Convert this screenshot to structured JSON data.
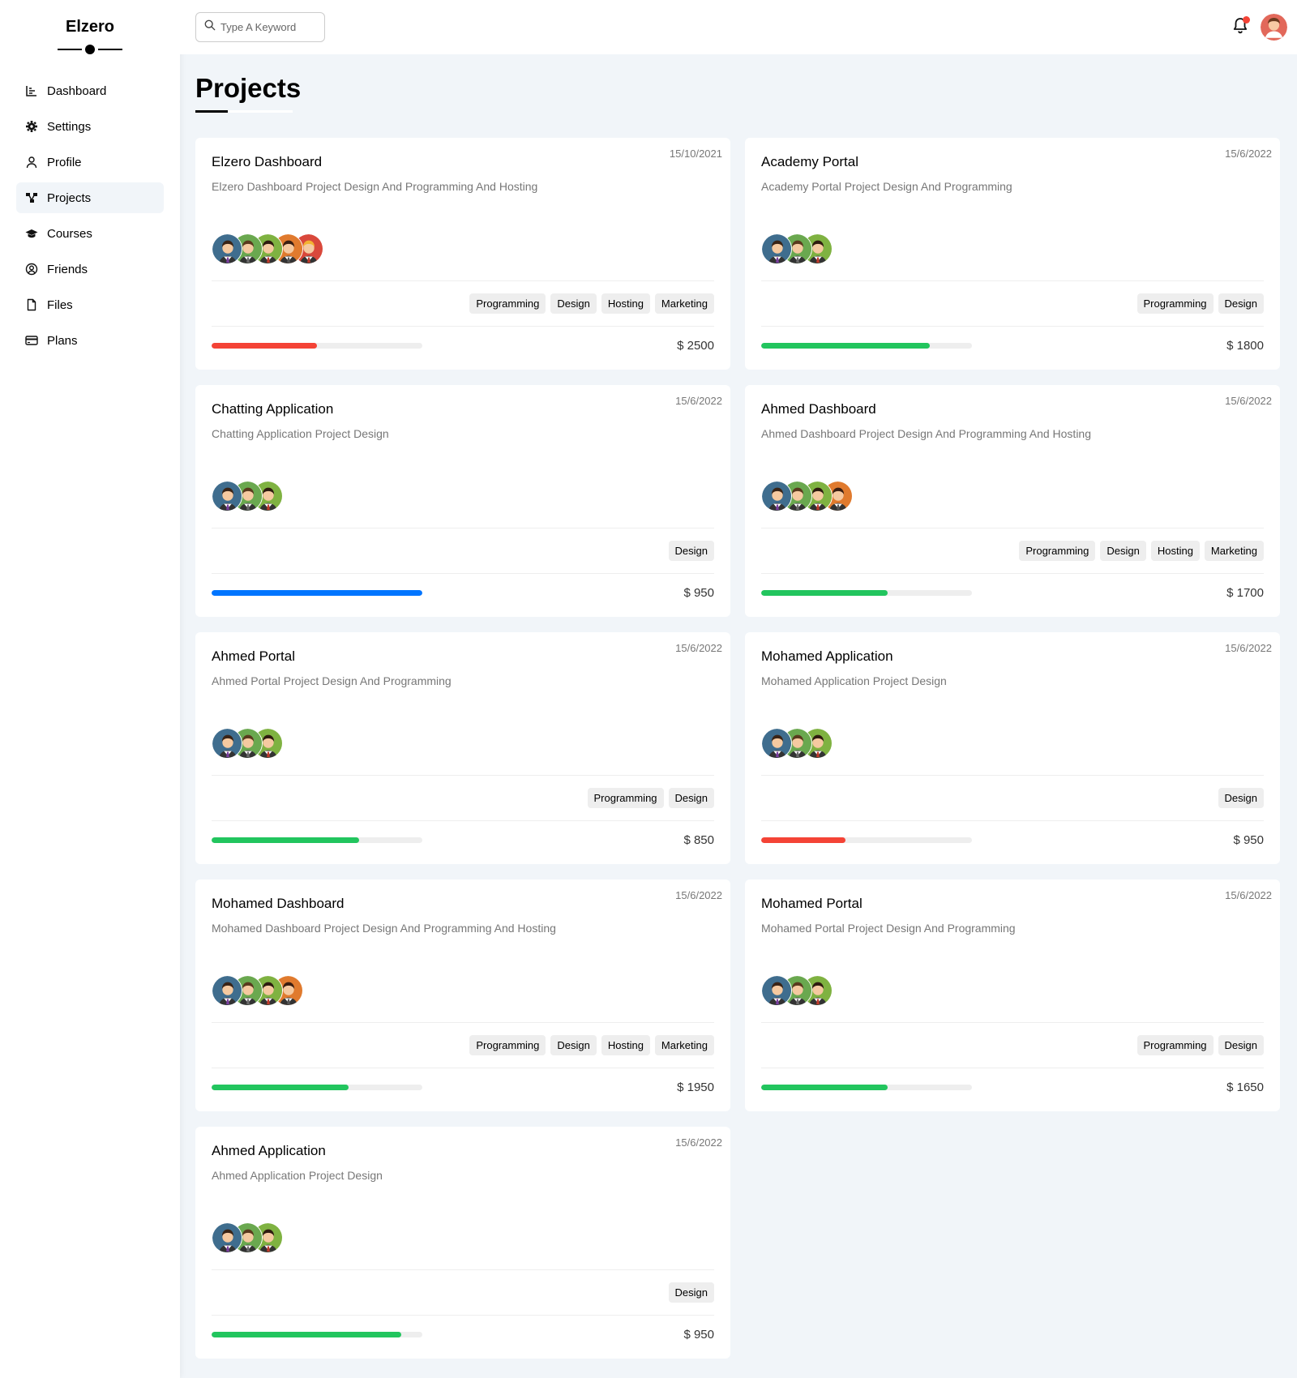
{
  "brand": "Elzero",
  "nav": [
    {
      "label": "Dashboard",
      "icon": "chart-icon"
    },
    {
      "label": "Settings",
      "icon": "gear-icon"
    },
    {
      "label": "Profile",
      "icon": "user-icon"
    },
    {
      "label": "Projects",
      "icon": "diagram-icon",
      "active": true
    },
    {
      "label": "Courses",
      "icon": "graduation-cap-icon"
    },
    {
      "label": "Friends",
      "icon": "user-circle-icon"
    },
    {
      "label": "Files",
      "icon": "file-icon"
    },
    {
      "label": "Plans",
      "icon": "credit-card-icon"
    }
  ],
  "search": {
    "placeholder": "Type A Keyword"
  },
  "page_title": "Projects",
  "colors": {
    "red": "#f44336",
    "green": "#22c55e",
    "blue": "#0075ff"
  },
  "projects": [
    {
      "name": "Elzero Dashboard",
      "date": "15/10/2021",
      "desc": "Elzero Dashboard Project Design And Programming And Hosting",
      "team": 5,
      "tags": [
        "Programming",
        "Design",
        "Hosting",
        "Marketing"
      ],
      "progress": 0.5,
      "color": "#f44336",
      "price": "$ 2500"
    },
    {
      "name": "Academy Portal",
      "date": "15/6/2022",
      "desc": "Academy Portal Project Design And Programming",
      "team": 3,
      "tags": [
        "Programming",
        "Design"
      ],
      "progress": 0.8,
      "color": "#22c55e",
      "price": "$ 1800"
    },
    {
      "name": "Chatting Application",
      "date": "15/6/2022",
      "desc": "Chatting Application Project Design",
      "team": 3,
      "tags": [
        "Design"
      ],
      "progress": 1.0,
      "color": "#0075ff",
      "price": "$ 950"
    },
    {
      "name": "Ahmed Dashboard",
      "date": "15/6/2022",
      "desc": "Ahmed Dashboard Project Design And Programming And Hosting",
      "team": 4,
      "tags": [
        "Programming",
        "Design",
        "Hosting",
        "Marketing"
      ],
      "progress": 0.6,
      "color": "#22c55e",
      "price": "$ 1700"
    },
    {
      "name": "Ahmed Portal",
      "date": "15/6/2022",
      "desc": "Ahmed Portal Project Design And Programming",
      "team": 3,
      "tags": [
        "Programming",
        "Design"
      ],
      "progress": 0.7,
      "color": "#22c55e",
      "price": "$ 850"
    },
    {
      "name": "Mohamed Application",
      "date": "15/6/2022",
      "desc": "Mohamed Application Project Design",
      "team": 3,
      "tags": [
        "Design"
      ],
      "progress": 0.4,
      "color": "#f44336",
      "price": "$ 950"
    },
    {
      "name": "Mohamed Dashboard",
      "date": "15/6/2022",
      "desc": "Mohamed Dashboard Project Design And Programming And Hosting",
      "team": 4,
      "tags": [
        "Programming",
        "Design",
        "Hosting",
        "Marketing"
      ],
      "progress": 0.65,
      "color": "#22c55e",
      "price": "$ 1950"
    },
    {
      "name": "Mohamed Portal",
      "date": "15/6/2022",
      "desc": "Mohamed Portal Project Design And Programming",
      "team": 3,
      "tags": [
        "Programming",
        "Design"
      ],
      "progress": 0.6,
      "color": "#22c55e",
      "price": "$ 1650"
    },
    {
      "name": "Ahmed Application",
      "date": "15/6/2022",
      "desc": "Ahmed Application Project Design",
      "team": 3,
      "tags": [
        "Design"
      ],
      "progress": 0.9,
      "color": "#22c55e",
      "price": "$ 950"
    }
  ]
}
